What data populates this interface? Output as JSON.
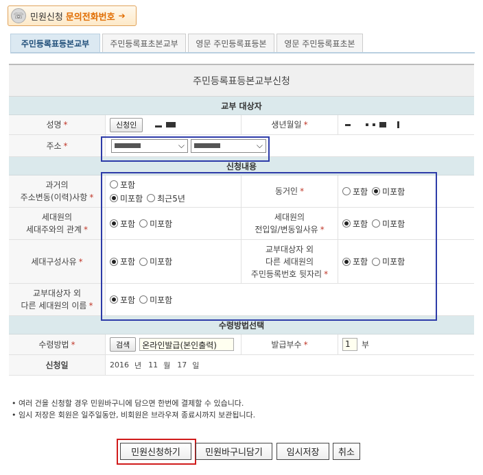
{
  "top_button": {
    "label": "민원신청",
    "highlight": "문의전화번호",
    "arrow": "➔"
  },
  "tabs": [
    {
      "label": "주민등록표등본교부",
      "active": true
    },
    {
      "label": "주민등록표초본교부",
      "active": false
    },
    {
      "label": "영문 주민등록표등본",
      "active": false
    },
    {
      "label": "영문 주민등록표초본",
      "active": false
    }
  ],
  "form_title": "주민등록표등본교부신청",
  "sections": {
    "target": "교부 대상자",
    "content": "신청내용",
    "receive": "수령방법선택"
  },
  "target": {
    "name_label": "성명",
    "applicant_button": "신청인",
    "birth_label": "생년월일",
    "address_label": "주소"
  },
  "content": {
    "history_label_1": "과거의",
    "history_label_2": "주소변동(이력)사항",
    "cohabitant_label": "동거인",
    "relation_label_1": "세대원의",
    "relation_label_2": "세대주와의 관계",
    "movein_label_1": "세대원의",
    "movein_label_2": "전입일/변동일사유",
    "composition_label": "세대구성사유",
    "idnum_label_1": "교부대상자 외",
    "idnum_label_2": "다른 세대원의",
    "idnum_label_3": "주민등록번호 뒷자리",
    "othername_label_1": "교부대상자 외",
    "othername_label_2": "다른 세대원의 이름",
    "include": "포함",
    "exclude": "미포함",
    "recent5": "최근5년"
  },
  "receive": {
    "method_label": "수령방법",
    "search_button": "검색",
    "method_value": "온라인발급(본인출력)",
    "copies_label": "발급부수",
    "copies_value": "1",
    "copies_unit": "부",
    "date_label": "신청일",
    "year": "2016",
    "year_unit": "년",
    "month": "11",
    "month_unit": "월",
    "day": "17",
    "day_unit": "일"
  },
  "notes": [
    "• 여러 건을 신청할 경우 민원바구니에 담으면 한번에 결제할 수 있습니다.",
    "• 임시 저장은 회원은 일주일동안, 비회원은 브라우져 종료시까지 보관됩니다."
  ],
  "buttons": {
    "apply": "민원신청하기",
    "basket": "민원바구니담기",
    "temp_save": "임시저장",
    "cancel": "취소"
  },
  "required_mark": "*",
  "colors": {
    "highlight_box": "#2c3aa8",
    "apply_box": "#d01a1a",
    "accent": "#e06c00"
  }
}
